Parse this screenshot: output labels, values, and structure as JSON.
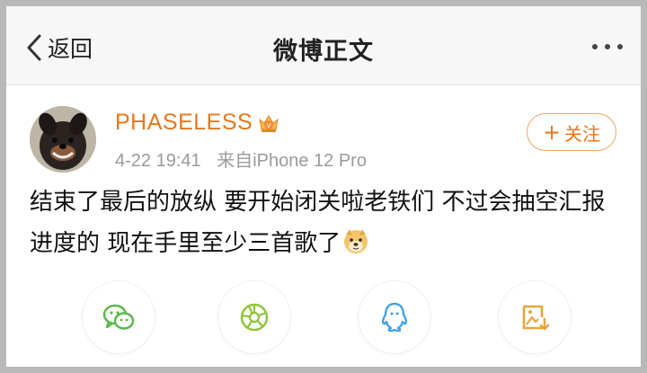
{
  "navbar": {
    "back_label": "返回",
    "title": "微博正文"
  },
  "post": {
    "username": "PHASELESS",
    "time": "4-22 19:41",
    "source": "来自iPhone 12 Pro",
    "follow_label": "关注",
    "content": "结束了最后的放纵 要开始闭关啦老铁们 不过会抽空汇报进度的 现在手里至少三首歌了",
    "icons": {
      "vip": "vip-crown-icon",
      "emoji": "doge-emoji-icon"
    }
  },
  "share": [
    {
      "name": "wechat-share-icon",
      "color": "#5bb84a"
    },
    {
      "name": "moments-share-icon",
      "color": "#8fc43d"
    },
    {
      "name": "qq-share-icon",
      "color": "#3da0e8"
    },
    {
      "name": "save-image-icon",
      "color": "#e8a43a"
    }
  ],
  "colors": {
    "accent": "#e8761e",
    "meta": "#9a9a9a",
    "border": "#b9b9b9"
  }
}
